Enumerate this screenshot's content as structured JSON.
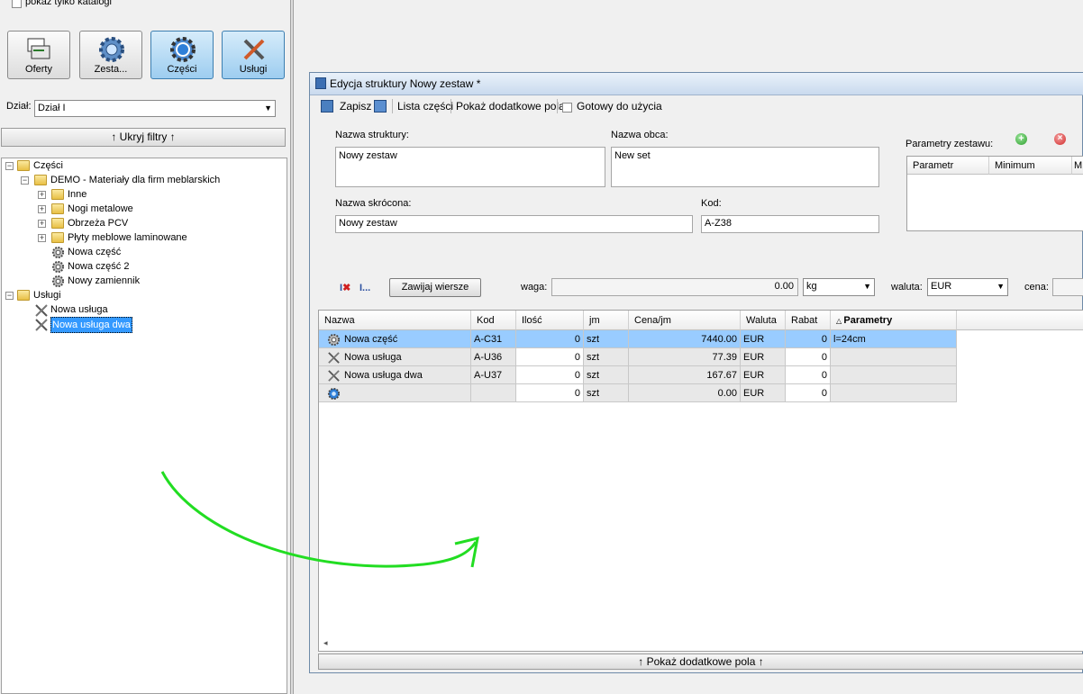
{
  "left": {
    "only_catalogs_label": "pokaż tylko katalogi",
    "buttons": [
      {
        "label": "Oferty",
        "icon": "offers-icon"
      },
      {
        "label": "Zesta...",
        "icon": "gear-icon"
      },
      {
        "label": "Części",
        "icon": "gear-icon"
      },
      {
        "label": "Usługi",
        "icon": "tools-icon"
      }
    ],
    "dept_label": "Dział:",
    "dept_value": "Dział I",
    "hide_filters": "↑ Ukryj filtry ↑",
    "tree": {
      "root1": "Części",
      "demo": "DEMO - Materiały dla firm meblarskich",
      "folders": [
        "Inne",
        "Nogi metalowe",
        "Obrzeża PCV",
        "Płyty meblowe laminowane"
      ],
      "parts": [
        "Nowa część",
        "Nowa część 2",
        "Nowy zamiennik"
      ],
      "root2": "Usługi",
      "services": [
        "Nowa usługa",
        "Nowa usługa dwa"
      ]
    }
  },
  "dialog": {
    "title": "Edycja struktury Nowy zestaw *",
    "toolbar": {
      "save": "Zapisz",
      "parts_list": "Lista części",
      "show_extra": "Pokaż dodatkowe pola",
      "ready": "Gotowy do użycia"
    },
    "form": {
      "name_label": "Nazwa struktury:",
      "name_value": "Nowy zestaw",
      "foreign_label": "Nazwa obca:",
      "foreign_value": "New set",
      "short_label": "Nazwa skrócona:",
      "short_value": "Nowy zestaw",
      "code_label": "Kod:",
      "code_value": "A-Z38",
      "params_label": "Parametry zestawu:",
      "params_cols": [
        "Parametr",
        "Minimum",
        "M"
      ]
    },
    "row2": {
      "wrap_button": "Zawijaj wiersze",
      "weight_label": "waga:",
      "weight_value": "0.00",
      "unit_value": "kg",
      "currency_label": "waluta:",
      "currency_value": "EUR",
      "price_label": "cena:",
      "ellipsis": "I..."
    },
    "grid": {
      "headers": [
        "Nazwa",
        "Kod",
        "Ilość",
        "jm",
        "Cena/jm",
        "Waluta",
        "Rabat",
        "Parametry"
      ],
      "rows": [
        {
          "icon": "gear-icon",
          "name": "Nowa część",
          "code": "A-C31",
          "qty": "0",
          "unit": "szt",
          "price": "7440.00",
          "currency": "EUR",
          "discount": "0",
          "params": "l=24cm"
        },
        {
          "icon": "tools-icon",
          "name": "Nowa usługa",
          "code": "A-U36",
          "qty": "0",
          "unit": "szt",
          "price": "77.39",
          "currency": "EUR",
          "discount": "0",
          "params": ""
        },
        {
          "icon": "tools-icon",
          "name": "Nowa usługa dwa",
          "code": "A-U37",
          "qty": "0",
          "unit": "szt",
          "price": "167.67",
          "currency": "EUR",
          "discount": "0",
          "params": ""
        },
        {
          "icon": "set-icon",
          "name": "",
          "code": "",
          "qty": "0",
          "unit": "szt",
          "price": "0.00",
          "currency": "EUR",
          "discount": "0",
          "params": ""
        }
      ]
    },
    "bottom_bar": "↑ Pokaż dodatkowe pola ↑"
  },
  "colors": {
    "selection": "#3399ff",
    "selected_row": "#99ccff",
    "arrow": "#22dd22"
  }
}
